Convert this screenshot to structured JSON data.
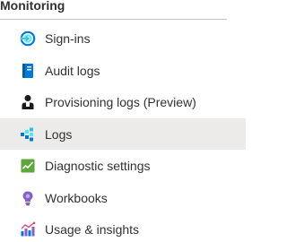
{
  "section": {
    "title": "Monitoring"
  },
  "nav": {
    "items": [
      {
        "label": "Sign-ins",
        "icon": "sign-ins-icon",
        "selected": false
      },
      {
        "label": "Audit logs",
        "icon": "audit-logs-icon",
        "selected": false
      },
      {
        "label": "Provisioning logs (Preview)",
        "icon": "provisioning-logs-icon",
        "selected": false
      },
      {
        "label": "Logs",
        "icon": "logs-icon",
        "selected": true
      },
      {
        "label": "Diagnostic settings",
        "icon": "diagnostic-settings-icon",
        "selected": false
      },
      {
        "label": "Workbooks",
        "icon": "workbooks-icon",
        "selected": false
      },
      {
        "label": "Usage & insights",
        "icon": "usage-insights-icon",
        "selected": false
      }
    ]
  },
  "colors": {
    "selected_background": "#edebe9",
    "text": "#323130",
    "divider": "#c8c6c4"
  }
}
